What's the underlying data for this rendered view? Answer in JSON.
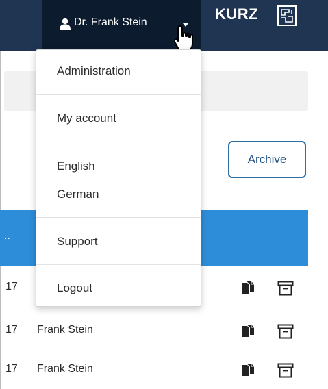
{
  "header": {
    "user_name": "Dr. Frank Stein",
    "brand": "KURZ",
    "bar_color": "#1f3552",
    "active_color": "#0d1b2f"
  },
  "user_menu": {
    "items": [
      {
        "label": "Administration"
      },
      {
        "label": "My account"
      },
      {
        "label": "English"
      },
      {
        "label": "German"
      },
      {
        "label": "Support"
      },
      {
        "label": "Logout"
      }
    ]
  },
  "toolbar": {
    "archive_label": "Archive"
  },
  "table": {
    "header_ellipsis": "..",
    "header_color": "#2e8dd8",
    "rows": [
      {
        "date": "17",
        "name": ""
      },
      {
        "date": "17",
        "name": "Frank Stein"
      },
      {
        "date": "17",
        "name": "Frank Stein"
      }
    ],
    "row_action_icons": [
      "copy-icon",
      "archive-box-icon"
    ]
  }
}
